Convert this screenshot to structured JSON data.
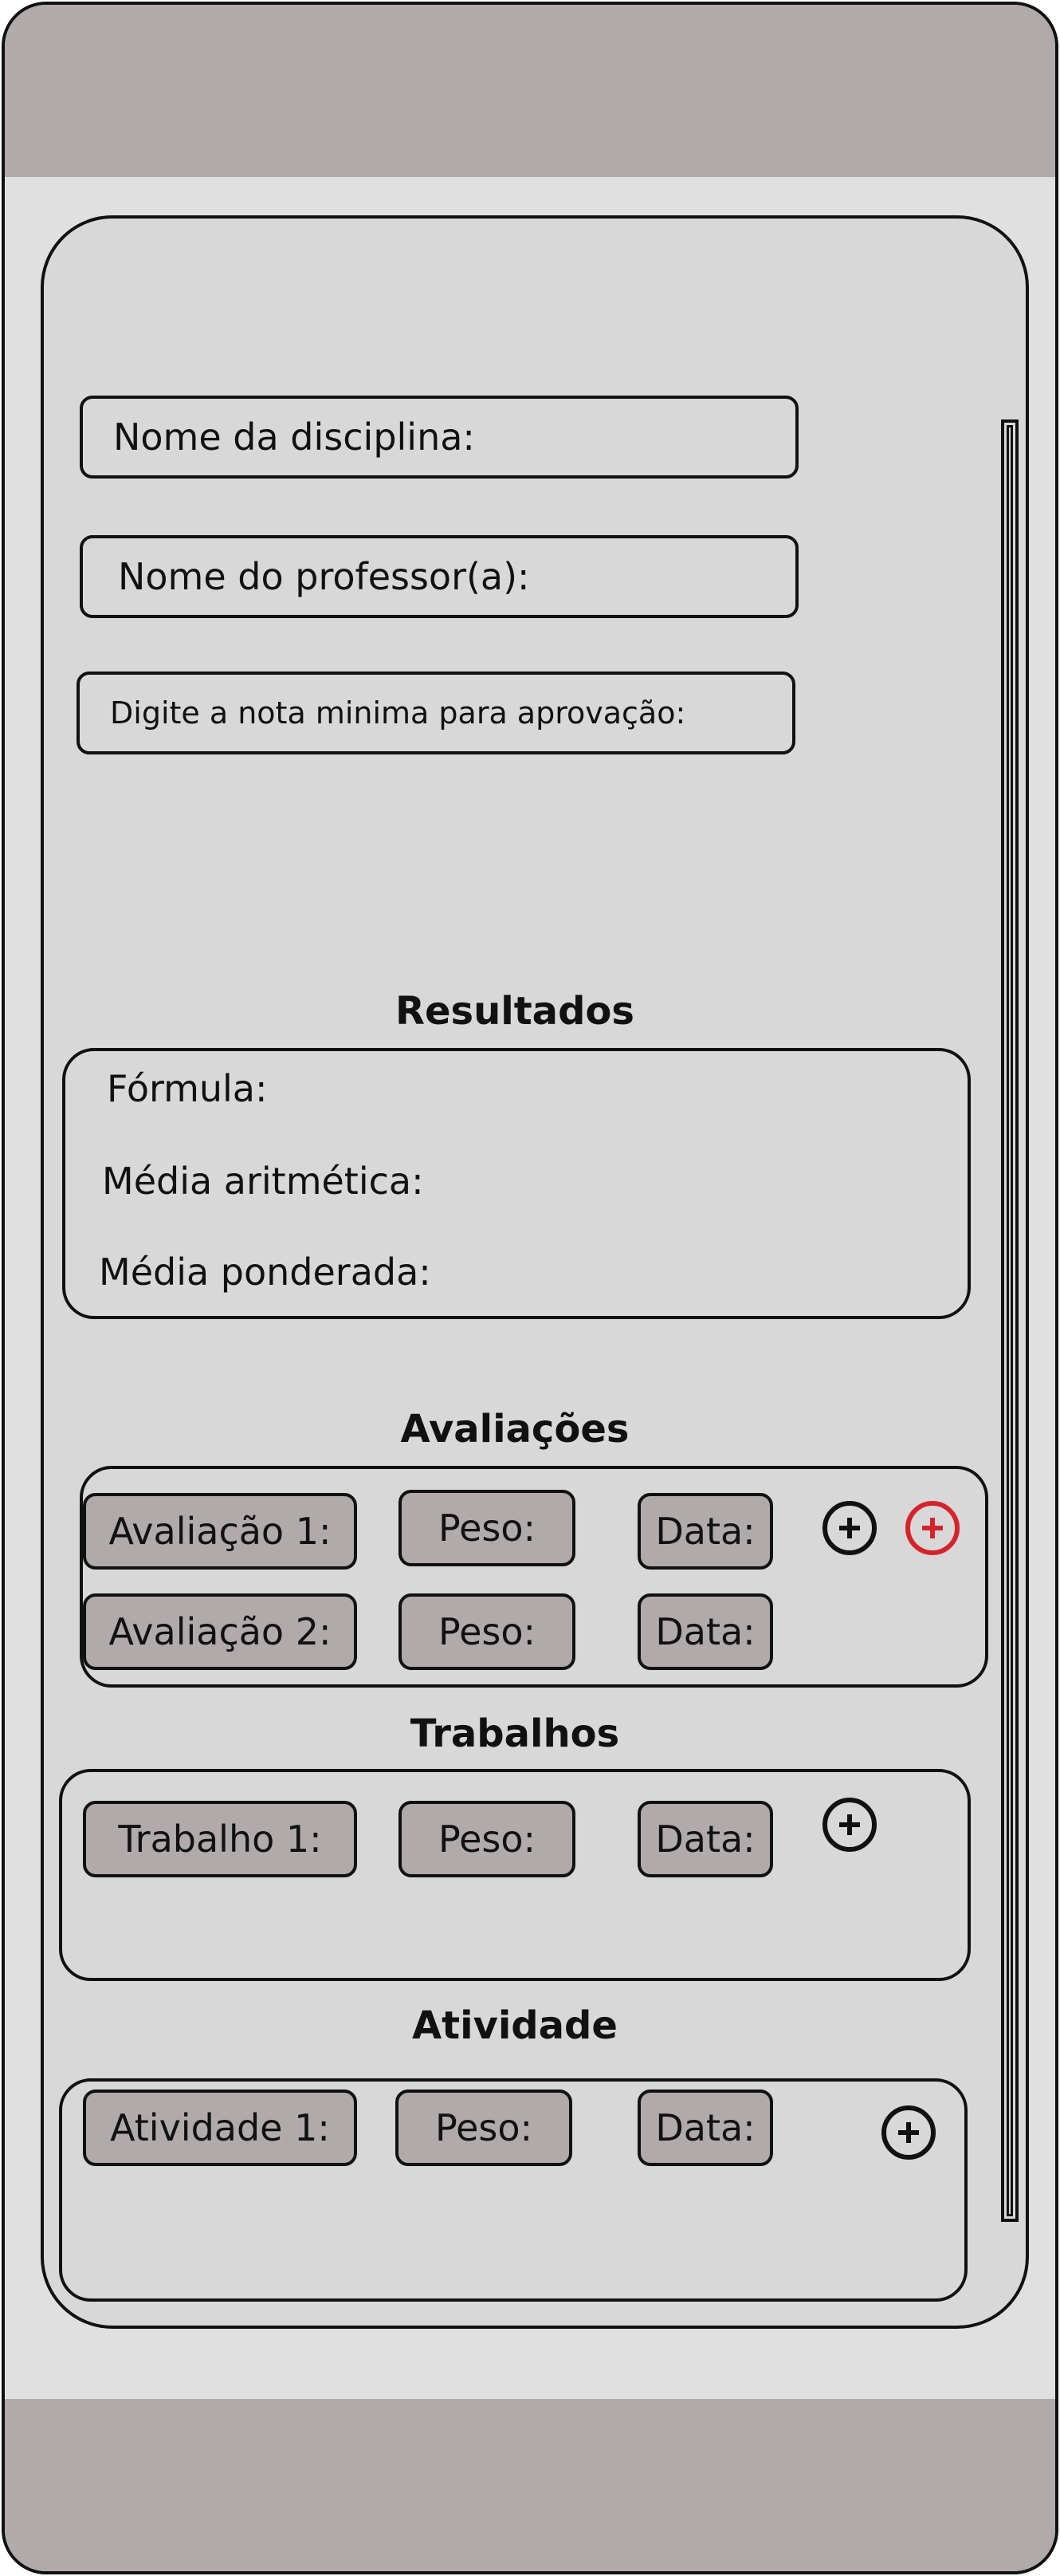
{
  "form": {
    "discipline_placeholder": "Nome da disciplina:",
    "professor_placeholder": "Nome do professor(a):",
    "min_grade_placeholder": "Digite a nota minima para aprovação:"
  },
  "results": {
    "title": "Resultados",
    "formula_label": "Fórmula:",
    "arithmetic_label": "Média aritmética:",
    "weighted_label": "Média ponderada:"
  },
  "evaluations": {
    "title": "Avaliações",
    "rows": [
      {
        "name": "Avaliação 1:",
        "weight": "Peso:",
        "date": "Data:"
      },
      {
        "name": "Avaliação 2:",
        "weight": "Peso:",
        "date": "Data:"
      }
    ]
  },
  "assignments": {
    "title": "Trabalhos",
    "rows": [
      {
        "name": "Trabalho 1:",
        "weight": "Peso:",
        "date": "Data:"
      }
    ]
  },
  "activities": {
    "title": "Atividade",
    "rows": [
      {
        "name": "Atividade 1:",
        "weight": "Peso:",
        "date": "Data:"
      }
    ]
  },
  "icons": {
    "add": "plus-circle-icon",
    "remove": "plus-circle-red-icon"
  },
  "colors": {
    "bars": "#b0aaab",
    "background": "#e0e0e0",
    "panel": "#d8d8d8",
    "accent_red": "#d6232b"
  }
}
